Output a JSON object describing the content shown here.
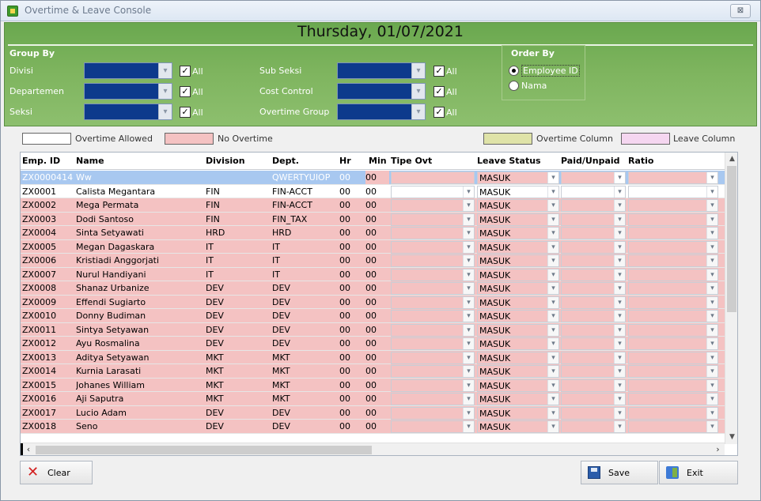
{
  "window": {
    "title": "Overtime & Leave Console",
    "close_symbol": "⊠"
  },
  "header": {
    "date": "Thursday, 01/07/2021",
    "group_by_label": "Group By",
    "order_by_label": "Order By",
    "filters_left": [
      {
        "label": "Divisi",
        "all_label": "All",
        "checked": "✓"
      },
      {
        "label": "Departemen",
        "all_label": "All",
        "checked": "✓"
      },
      {
        "label": "Seksi",
        "all_label": "All",
        "checked": "✓"
      }
    ],
    "filters_right": [
      {
        "label": "Sub Seksi",
        "all_label": "All",
        "checked": "✓"
      },
      {
        "label": "Cost Control",
        "all_label": "All",
        "checked": "✓"
      },
      {
        "label": "Overtime Group",
        "all_label": "All",
        "checked": "✓"
      }
    ],
    "order_options": [
      {
        "label": "Employee ID",
        "selected": true
      },
      {
        "label": "Nama",
        "selected": false
      }
    ]
  },
  "legend": {
    "overtime_allowed": "Overtime Allowed",
    "no_overtime": "No Overtime",
    "overtime_column": "Overtime Column",
    "leave_column": "Leave Column",
    "colors": {
      "allowed": "#ffffff",
      "no_overtime": "#f4c2c2",
      "overtime_col": "#dfe3a8",
      "leave_col": "#f5d6f0"
    }
  },
  "grid": {
    "columns": [
      "Emp. ID",
      "Name",
      "Division",
      "Dept.",
      "Hr",
      "Min",
      "Tipe Ovt",
      "Leave Status",
      "Paid/Unpaid",
      "Ratio"
    ],
    "rows": [
      {
        "id": "ZX0000414",
        "name": "Ww",
        "div": "",
        "dept": "QWERTYUIOP",
        "hr": "00",
        "min": "00",
        "leave": "MASUK",
        "state": "selected"
      },
      {
        "id": "ZX0001",
        "name": "Calista Megantara",
        "div": "FIN",
        "dept": "FIN-ACCT",
        "hr": "00",
        "min": "00",
        "leave": "MASUK",
        "state": "white"
      },
      {
        "id": "ZX0002",
        "name": "Mega Permata",
        "div": "FIN",
        "dept": "FIN-ACCT",
        "hr": "00",
        "min": "00",
        "leave": "MASUK",
        "state": "pink"
      },
      {
        "id": "ZX0003",
        "name": "Dodi Santoso",
        "div": "FIN",
        "dept": "FIN_TAX",
        "hr": "00",
        "min": "00",
        "leave": "MASUK",
        "state": "pink"
      },
      {
        "id": "ZX0004",
        "name": "Sinta Setyawati",
        "div": "HRD",
        "dept": "HRD",
        "hr": "00",
        "min": "00",
        "leave": "MASUK",
        "state": "pink"
      },
      {
        "id": "ZX0005",
        "name": "Megan Dagaskara",
        "div": "IT",
        "dept": "IT",
        "hr": "00",
        "min": "00",
        "leave": "MASUK",
        "state": "pink"
      },
      {
        "id": "ZX0006",
        "name": "Kristiadi Anggorjati",
        "div": "IT",
        "dept": "IT",
        "hr": "00",
        "min": "00",
        "leave": "MASUK",
        "state": "pink"
      },
      {
        "id": "ZX0007",
        "name": "Nurul Handiyani",
        "div": "IT",
        "dept": "IT",
        "hr": "00",
        "min": "00",
        "leave": "MASUK",
        "state": "pink"
      },
      {
        "id": "ZX0008",
        "name": "Shanaz Urbanize",
        "div": "DEV",
        "dept": "DEV",
        "hr": "00",
        "min": "00",
        "leave": "MASUK",
        "state": "pink"
      },
      {
        "id": "ZX0009",
        "name": "Effendi Sugiarto",
        "div": "DEV",
        "dept": "DEV",
        "hr": "00",
        "min": "00",
        "leave": "MASUK",
        "state": "pink"
      },
      {
        "id": "ZX0010",
        "name": "Donny Budiman",
        "div": "DEV",
        "dept": "DEV",
        "hr": "00",
        "min": "00",
        "leave": "MASUK",
        "state": "pink"
      },
      {
        "id": "ZX0011",
        "name": "Sintya Setyawan",
        "div": "DEV",
        "dept": "DEV",
        "hr": "00",
        "min": "00",
        "leave": "MASUK",
        "state": "pink"
      },
      {
        "id": "ZX0012",
        "name": "Ayu Rosmalina",
        "div": "DEV",
        "dept": "DEV",
        "hr": "00",
        "min": "00",
        "leave": "MASUK",
        "state": "pink"
      },
      {
        "id": "ZX0013",
        "name": "Aditya Setyawan",
        "div": "MKT",
        "dept": "MKT",
        "hr": "00",
        "min": "00",
        "leave": "MASUK",
        "state": "pink"
      },
      {
        "id": "ZX0014",
        "name": "Kurnia Larasati",
        "div": "MKT",
        "dept": "MKT",
        "hr": "00",
        "min": "00",
        "leave": "MASUK",
        "state": "pink"
      },
      {
        "id": "ZX0015",
        "name": "Johanes William",
        "div": "MKT",
        "dept": "MKT",
        "hr": "00",
        "min": "00",
        "leave": "MASUK",
        "state": "pink"
      },
      {
        "id": "ZX0016",
        "name": "Aji Saputra",
        "div": "MKT",
        "dept": "MKT",
        "hr": "00",
        "min": "00",
        "leave": "MASUK",
        "state": "pink"
      },
      {
        "id": "ZX0017",
        "name": "Lucio Adam",
        "div": "DEV",
        "dept": "DEV",
        "hr": "00",
        "min": "00",
        "leave": "MASUK",
        "state": "pink"
      },
      {
        "id": "ZX0018",
        "name": "Seno",
        "div": "DEV",
        "dept": "DEV",
        "hr": "00",
        "min": "00",
        "leave": "MASUK",
        "state": "pink"
      }
    ]
  },
  "footer": {
    "clear_label": "Clear",
    "save_label": "Save",
    "exit_label": "Exit"
  },
  "icons": [
    "app-icon",
    "close-icon",
    "chevron-down-icon",
    "clear-x-icon",
    "save-disk-icon",
    "exit-door-icon"
  ],
  "colors": {
    "header_green": "#7fb55f",
    "combo_blue": "#0d3a8c",
    "row_pink": "#f4c2c2",
    "row_selected": "#a8c8f0"
  }
}
